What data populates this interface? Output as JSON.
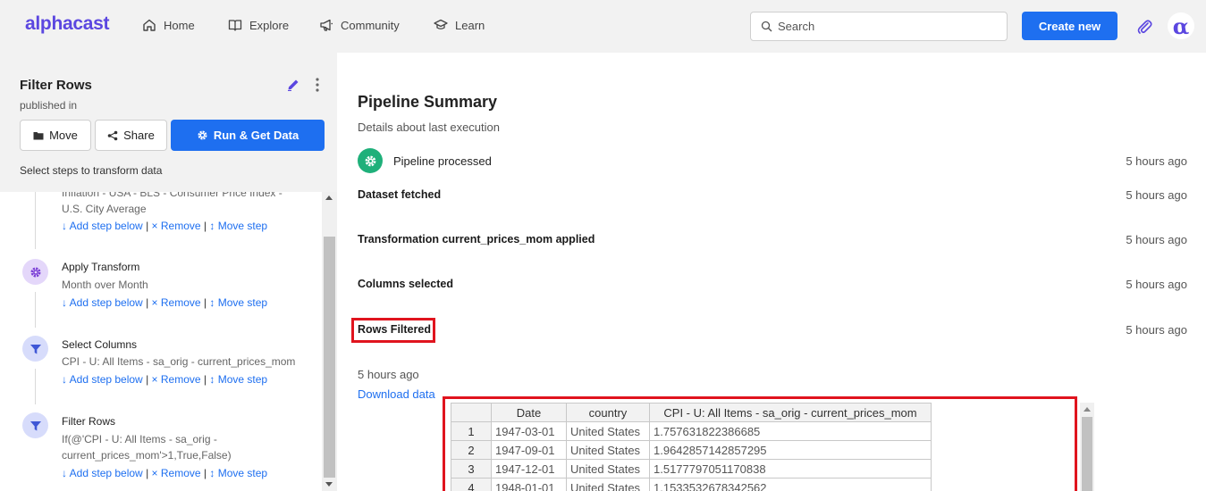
{
  "header": {
    "logo": "alphacast",
    "nav": [
      {
        "label": "Home",
        "icon": "home-icon"
      },
      {
        "label": "Explore",
        "icon": "book-icon"
      },
      {
        "label": "Community",
        "icon": "megaphone-icon"
      },
      {
        "label": "Learn",
        "icon": "graduation-cap-icon"
      }
    ],
    "search_placeholder": "Search",
    "create_label": "Create new",
    "avatar_glyph": "α",
    "accent_color": "#5b47e0",
    "primary_color": "#1e6ff0"
  },
  "panel": {
    "title": "Filter Rows",
    "subtitle": "published in",
    "move_label": "Move",
    "share_label": "Share",
    "run_label": "Run & Get Data",
    "steps_hint": "Select steps to transform data",
    "step_actions": {
      "add": "↓ Add step below",
      "remove": "× Remove",
      "move": "↕ Move step",
      "separator": "|"
    },
    "steps": [
      {
        "title": "",
        "desc_line1": "Inflation - USA - BLS - Consumer Price Index -",
        "desc_line2": "U.S. City Average",
        "icon": ""
      },
      {
        "title": "Apply Transform",
        "desc_line1": "Month over Month",
        "desc_line2": "",
        "icon": "gear-icon"
      },
      {
        "title": "Select Columns",
        "desc_line1": "CPI - U: All Items - sa_orig - current_prices_mom",
        "desc_line2": "",
        "icon": "filter-icon"
      },
      {
        "title": "Filter Rows",
        "desc_line1": "If(@'CPI - U: All Items - sa_orig -",
        "desc_line2": "current_prices_mom'>1,True,False)",
        "icon": "filter-icon"
      }
    ]
  },
  "summary": {
    "title": "Pipeline Summary",
    "subtitle": "Details about last execution",
    "events": [
      {
        "label": "Pipeline processed",
        "time": "5 hours ago"
      },
      {
        "label": "Dataset fetched",
        "time": "5 hours ago"
      },
      {
        "label": "Transformation current_prices_mom applied",
        "time": "5 hours ago"
      },
      {
        "label": "Columns selected",
        "time": "5 hours ago"
      },
      {
        "label": "Rows Filtered",
        "time": "5 hours ago"
      }
    ],
    "last_time": "5 hours ago",
    "download_label": "Download data",
    "highlight_color": "#e0141e"
  },
  "table": {
    "columns": [
      "",
      "Date",
      "country",
      "CPI - U: All Items - sa_orig - current_prices_mom"
    ],
    "rows": [
      {
        "idx": "1",
        "date": "1947-03-01",
        "country": "United States",
        "value": "1.757631822386685"
      },
      {
        "idx": "2",
        "date": "1947-09-01",
        "country": "United States",
        "value": "1.9642857142857295"
      },
      {
        "idx": "3",
        "date": "1947-12-01",
        "country": "United States",
        "value": "1.5177797051170838"
      },
      {
        "idx": "4",
        "date": "1948-01-01",
        "country": "United States",
        "value": "1.1533532678342562"
      }
    ]
  }
}
